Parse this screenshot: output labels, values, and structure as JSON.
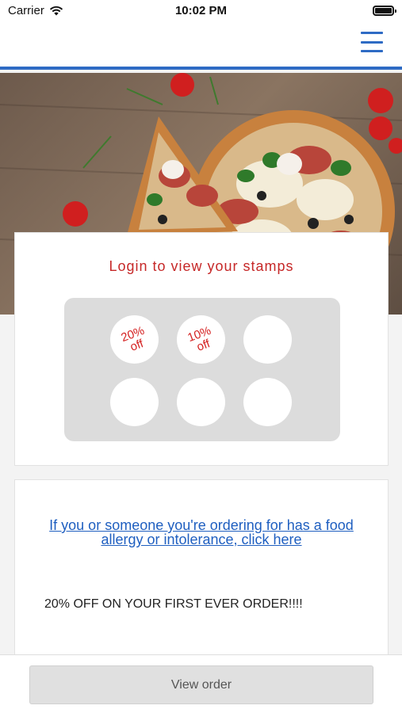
{
  "status_bar": {
    "carrier": "Carrier",
    "time": "10:02 PM"
  },
  "nav": {
    "menu_icon": "hamburger-menu-icon"
  },
  "hero": {
    "image": "pizza-photo"
  },
  "stamps": {
    "title": "Login to view your stamps",
    "items": [
      {
        "label": "20% off"
      },
      {
        "label": "10% off"
      },
      {
        "label": ""
      },
      {
        "label": ""
      },
      {
        "label": ""
      },
      {
        "label": ""
      }
    ],
    "stamp_text_color": "#d42020"
  },
  "info": {
    "allergy_link": "If you or someone you're ordering for has a food allergy or intolerance, click here",
    "promo": "20% OFF ON YOUR FIRST EVER ORDER!!!!"
  },
  "footer": {
    "view_order_label": "View order"
  },
  "colors": {
    "accent": "#2e6bc4",
    "title_red": "#c62828",
    "link_blue": "#1f5fc0"
  }
}
